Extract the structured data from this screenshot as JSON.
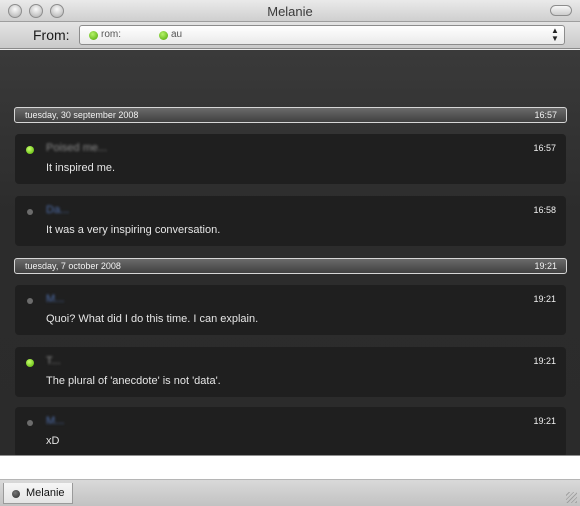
{
  "window": {
    "title": "Melanie"
  },
  "toolbar": {
    "from_label": "From:",
    "selected_account_1": "rom:",
    "selected_account_2": "au"
  },
  "conversation": [
    {
      "type": "date",
      "date": "tuesday, 30 september 2008",
      "time": "16:57"
    },
    {
      "type": "message",
      "status": "online",
      "sender": "Poised me...",
      "time": "16:57",
      "text": "It inspired me."
    },
    {
      "type": "message",
      "status": "offline",
      "sender": "Da...",
      "time": "16:58",
      "text": "It was a very inspiring conversation."
    },
    {
      "type": "date",
      "date": "tuesday, 7 october 2008",
      "time": "19:21"
    },
    {
      "type": "message",
      "status": "offline",
      "sender": "M...",
      "time": "19:21",
      "text": "Quoi? What did I do this time. I can explain."
    },
    {
      "type": "message",
      "status": "online",
      "sender": "T...",
      "time": "19:21",
      "text": "The plural of 'anecdote' is not 'data'."
    },
    {
      "type": "message",
      "status": "offline",
      "sender": "M...",
      "time": "19:21",
      "text": "xD"
    }
  ],
  "input": {
    "value": ""
  },
  "tabs": [
    {
      "label": "Melanie"
    }
  ]
}
